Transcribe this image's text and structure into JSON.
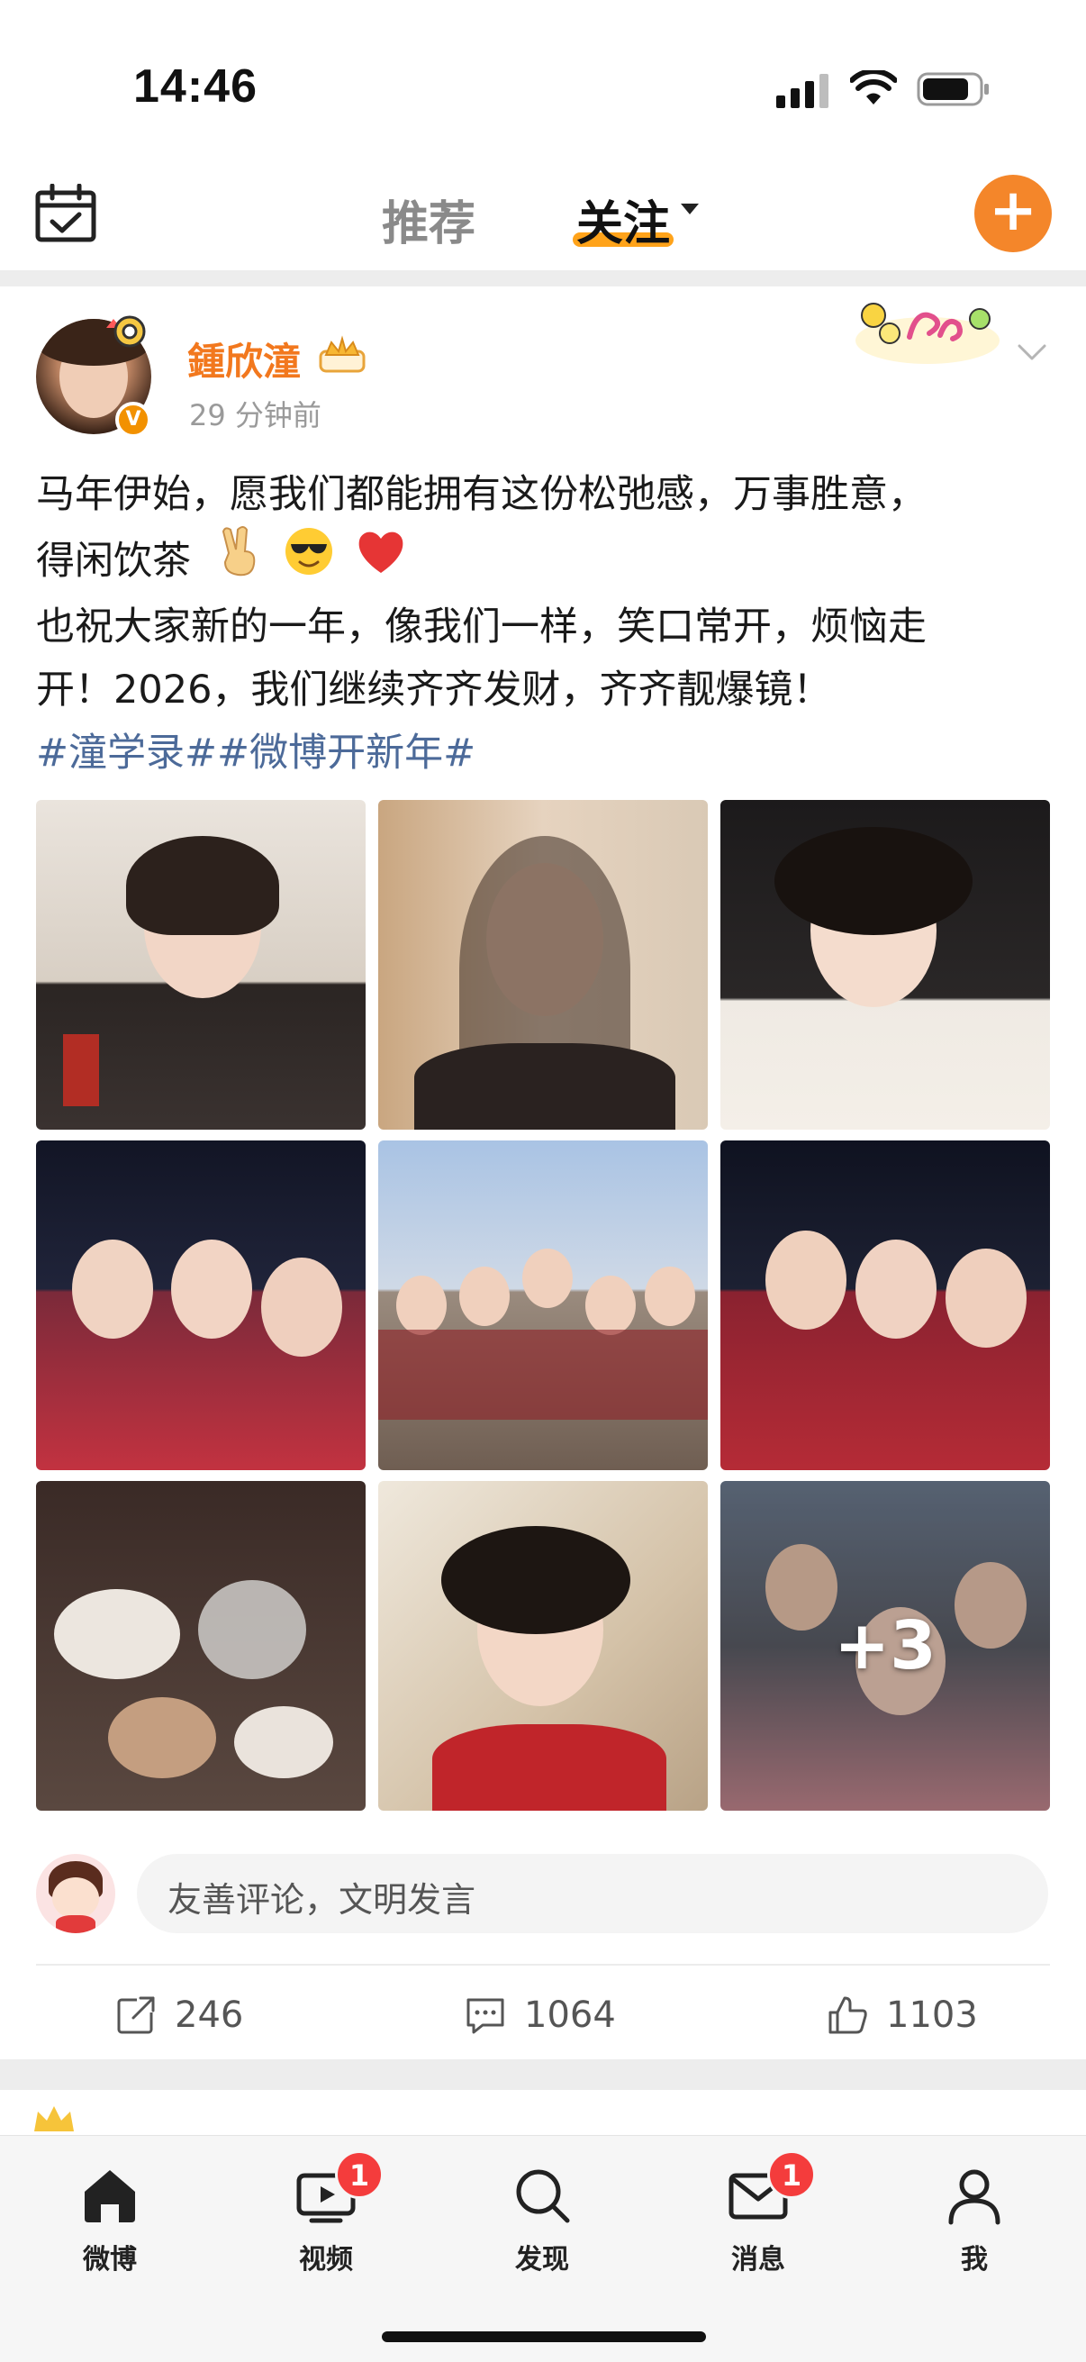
{
  "status_bar": {
    "time": "14:46"
  },
  "top_nav": {
    "tabs": [
      {
        "label": "推荐",
        "active": false
      },
      {
        "label": "关注",
        "active": true
      }
    ],
    "accent_color": "#f4862a"
  },
  "post": {
    "author": "鍾欣潼",
    "time_ago": "29 分钟前",
    "text_lines": [
      "马年伊始，愿我们都能拥有这份松弛感，万事胜意，",
      "得闲饮茶",
      "也祝大家新的一年，像我们一样，笑口常开，烦恼走",
      "开！2026，我们继续齐齐发财，齐齐靓爆镜！"
    ],
    "emojis": [
      "victory-hand",
      "sunglasses-face",
      "red-heart"
    ],
    "hashtags": "#潼学录##微博开新年#",
    "photo_more_label": "+3",
    "comment_placeholder": "友善评论，文明发言",
    "actions": {
      "repost_count": "246",
      "comment_count": "1064",
      "like_count": "1103"
    }
  },
  "tab_bar": {
    "items": [
      {
        "label": "微博",
        "icon": "home-icon",
        "badge": ""
      },
      {
        "label": "视频",
        "icon": "video-icon",
        "badge": "1"
      },
      {
        "label": "发现",
        "icon": "search-icon",
        "badge": ""
      },
      {
        "label": "消息",
        "icon": "mail-icon",
        "badge": "1"
      },
      {
        "label": "我",
        "icon": "profile-icon",
        "badge": ""
      }
    ]
  },
  "colors": {
    "username": "#f2781e",
    "hashtag": "#4c6a99",
    "badge": "#f43c3c"
  }
}
